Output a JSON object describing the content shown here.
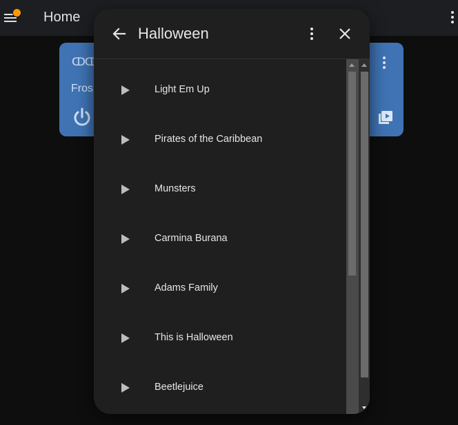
{
  "topbar": {
    "title": "Home",
    "menu_icon": "menu-icon",
    "more_icon": "more-vert-icon",
    "notification_color": "#ff9800"
  },
  "card": {
    "name": "Fros",
    "color": "#3f73b3",
    "icons": [
      "string-lights-icon",
      "power-icon",
      "more-vert-icon",
      "playlist-play-icon"
    ]
  },
  "dialog": {
    "title": "Halloween",
    "back_icon": "arrow-left-icon",
    "more_icon": "more-vert-icon",
    "close_icon": "close-icon",
    "items": [
      {
        "label": "Light Em Up"
      },
      {
        "label": "Pirates of the Caribbean"
      },
      {
        "label": "Munsters"
      },
      {
        "label": "Carmina Burana"
      },
      {
        "label": "Adams Family"
      },
      {
        "label": "This is Halloween"
      },
      {
        "label": "Beetlejuice"
      }
    ]
  }
}
